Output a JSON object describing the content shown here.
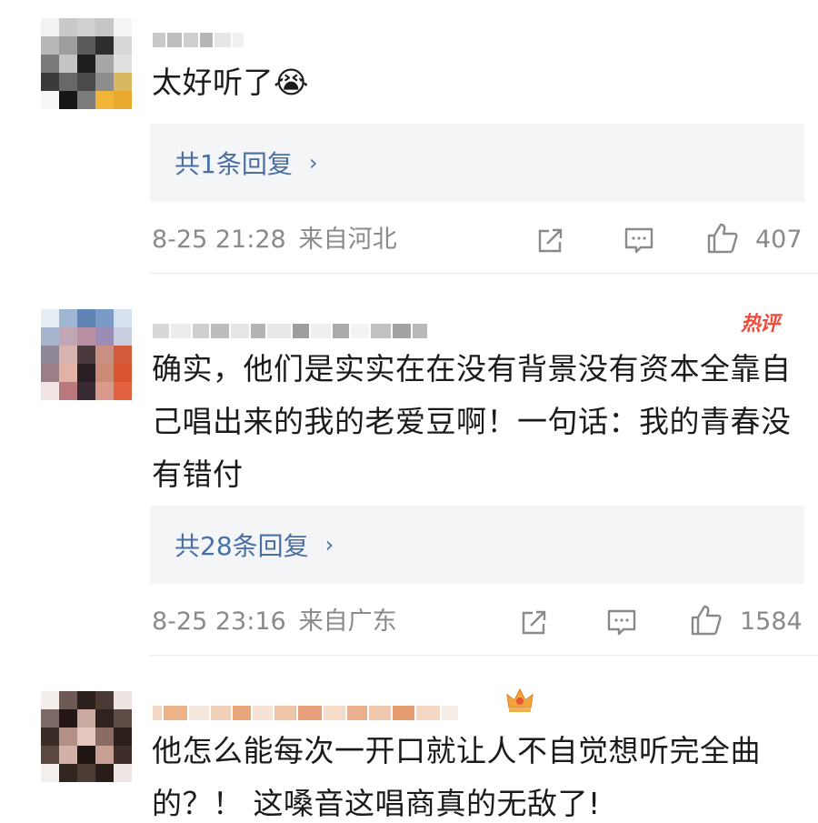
{
  "comments": [
    {
      "text": "太好听了😭",
      "reply_label": "共1条回复",
      "reply_chevron": "›",
      "date": "8-25 21:28",
      "location": "来自河北",
      "likes": "407",
      "icons": [
        "share-icon",
        "comment-icon",
        "like-icon"
      ]
    },
    {
      "badge": "热评",
      "text": "确实，他们是实实在在没有背景没有资本全靠自己唱出来的我的老爱豆啊！一句话：我的青春没有错付",
      "reply_label": "共28条回复",
      "reply_chevron": "›",
      "date": "8-25 23:16",
      "location": "来自广东",
      "likes": "1584",
      "icons": [
        "share-icon",
        "comment-icon",
        "like-icon"
      ]
    },
    {
      "text": "他怎么能每次一开口就让人不自觉想听完全曲的？！ 这嗓音这唱商真的无敌了!",
      "user_badge_icon": "crown-icon"
    }
  ],
  "colors": {
    "link": "#4a6fa3",
    "meta": "#8a8a8a",
    "hot_badge": "#f04a3a",
    "reply_bg": "#f4f5f7"
  }
}
